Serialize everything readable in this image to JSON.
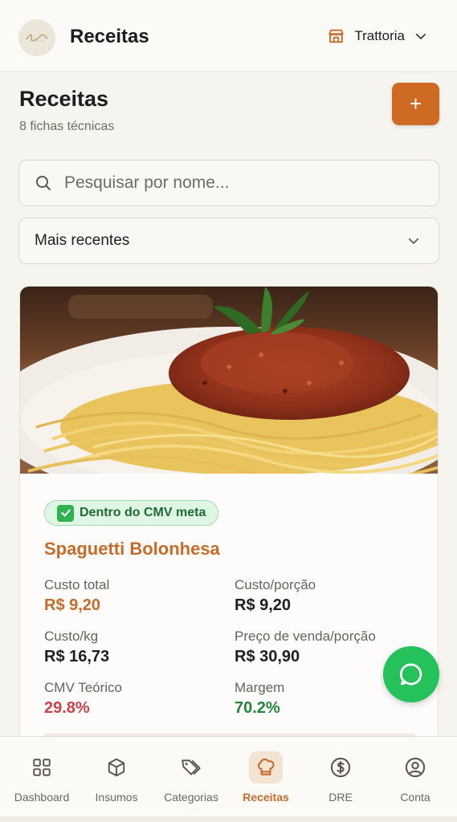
{
  "header": {
    "title": "Receitas",
    "store": "Trattoria",
    "logo_icon": "restaurant-logo",
    "store_icon": "store-icon"
  },
  "page": {
    "title": "Receitas",
    "subtitle": "8 fichas técnicas",
    "add_label": "+"
  },
  "search": {
    "placeholder": "Pesquisar por nome...",
    "value": ""
  },
  "sort": {
    "value": "Mais recentes"
  },
  "recipes": [
    {
      "badge": "Dentro do CMV meta",
      "name": "Spaguetti Bolonhesa",
      "metrics": {
        "custo_total": {
          "label": "Custo total",
          "value": "R$ 9,20"
        },
        "custo_porcao": {
          "label": "Custo/porção",
          "value": "R$ 9,20"
        },
        "custo_kg": {
          "label": "Custo/kg",
          "value": "R$ 16,73"
        },
        "preco_venda": {
          "label": "Preço de venda/porção",
          "value": "R$ 30,90"
        },
        "cmv": {
          "label": "CMV Teórico",
          "value": "29.8%"
        },
        "margem": {
          "label": "Margem",
          "value": "70.2%"
        }
      }
    }
  ],
  "nav": [
    {
      "label": "Dashboard",
      "icon": "dashboard-icon"
    },
    {
      "label": "Insumos",
      "icon": "box-icon"
    },
    {
      "label": "Categorias",
      "icon": "tags-icon"
    },
    {
      "label": "Receitas",
      "icon": "chef-hat-icon",
      "active": true
    },
    {
      "label": "DRE",
      "icon": "dollar-circle-icon"
    },
    {
      "label": "Conta",
      "icon": "user-circle-icon"
    }
  ],
  "colors": {
    "accent": "#cf6a22",
    "success": "#22863a",
    "danger": "#d0404a",
    "whatsapp": "#25c15a"
  }
}
